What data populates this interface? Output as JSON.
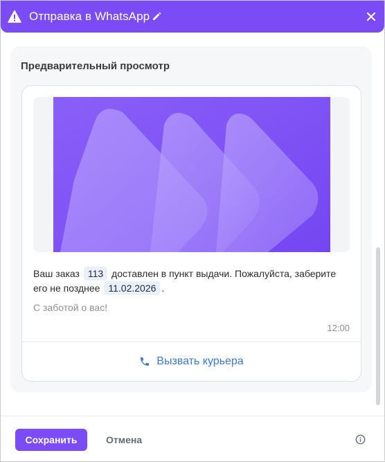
{
  "header": {
    "title": "Отправка в WhatsApp",
    "icons": {
      "warning": "warning-icon",
      "edit": "pencil-icon",
      "close": "close-icon"
    },
    "background_color": "#7b4cf5"
  },
  "preview": {
    "heading": "Предварительный просмотр",
    "message": {
      "part1": "Ваш заказ",
      "var_order": "113",
      "part2": "доставлен в пункт выдачи. Пожалуйста, заберите его не позднее",
      "var_date": "11.02.2026",
      "part3": "."
    },
    "footer": "С заботой о вас!",
    "time": "12:00",
    "action_button": {
      "label": "Вызвать курьера",
      "icon": "phone-icon",
      "color": "#3a79d6"
    }
  },
  "actions": {
    "save_label": "Сохранить",
    "cancel_label": "Отмена",
    "info_icon": "info-icon"
  },
  "colors": {
    "accent": "#7b4cf5",
    "chip_background": "#e8f0fb"
  }
}
